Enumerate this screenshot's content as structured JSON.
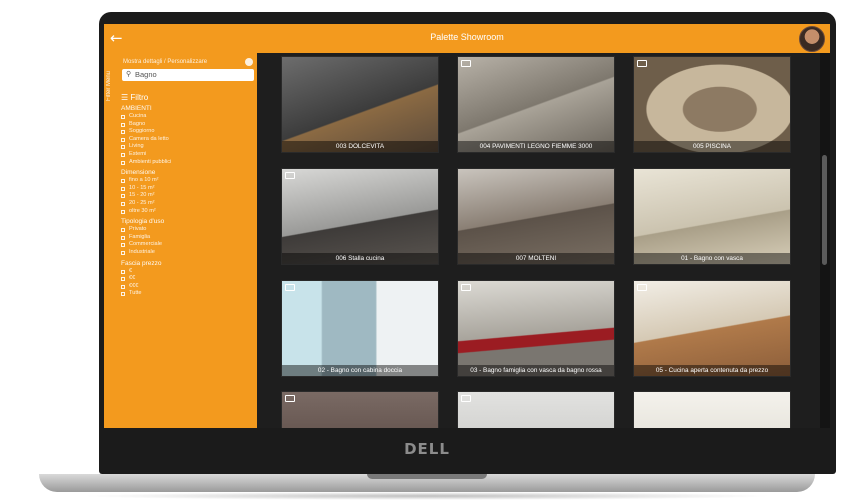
{
  "app": {
    "title": "Palette Showroom",
    "back_icon": "arrow-left-icon",
    "avatar_icon": "user-avatar"
  },
  "sidebar": {
    "tab_label": "Filter Menu",
    "toggle_label": "Mostra dettagli / Personalizzare",
    "search": {
      "value": "Bagno",
      "icon": "search-icon"
    },
    "filters_heading": "Filtro",
    "groups": [
      {
        "title": "AMBIENTI",
        "options": [
          "Cucina",
          "Bagno",
          "Soggiorno",
          "Camera da letto",
          "Living",
          "Esterni",
          "Ambienti pubblici"
        ]
      },
      {
        "title": "Dimensione",
        "options": [
          "fino a 10 m²",
          "10 - 15 m²",
          "15 - 20 m²",
          "20 - 25 m²",
          "oltre 30 m²"
        ]
      },
      {
        "title": "Tipologia d'uso",
        "options": [
          "Privato",
          "Famiglia",
          "Commerciale",
          "Industriale"
        ]
      },
      {
        "title": "Fascia prezzo",
        "options": [
          "€",
          "€€",
          "€€€",
          "Tutte"
        ]
      }
    ]
  },
  "tiles": [
    {
      "caption": "003 DOLCEVITA",
      "badge": false
    },
    {
      "caption": "004 PAVIMENTI LEGNO FIEMME 3000",
      "badge": true
    },
    {
      "caption": "005 PISCINA",
      "badge": true
    },
    {
      "caption": "006 Stalla cucina",
      "badge": true
    },
    {
      "caption": "007 MOLTENI",
      "badge": false
    },
    {
      "caption": "01 - Bagno con vasca",
      "badge": false
    },
    {
      "caption": "02 - Bagno con cabina doccia",
      "badge": true
    },
    {
      "caption": "03 - Bagno famiglia con vasca da bagno rossa",
      "badge": true
    },
    {
      "caption": "05 - Cucina aperta contenuta da prezzo",
      "badge": true
    },
    {
      "caption": "",
      "badge": true
    },
    {
      "caption": "",
      "badge": true
    },
    {
      "caption": "",
      "badge": false
    }
  ],
  "laptop": {
    "brand": "DELL"
  },
  "colors": {
    "accent": "#f39a1e",
    "screen_bg": "#1e1e1e",
    "bezel": "#1b1b1b"
  }
}
